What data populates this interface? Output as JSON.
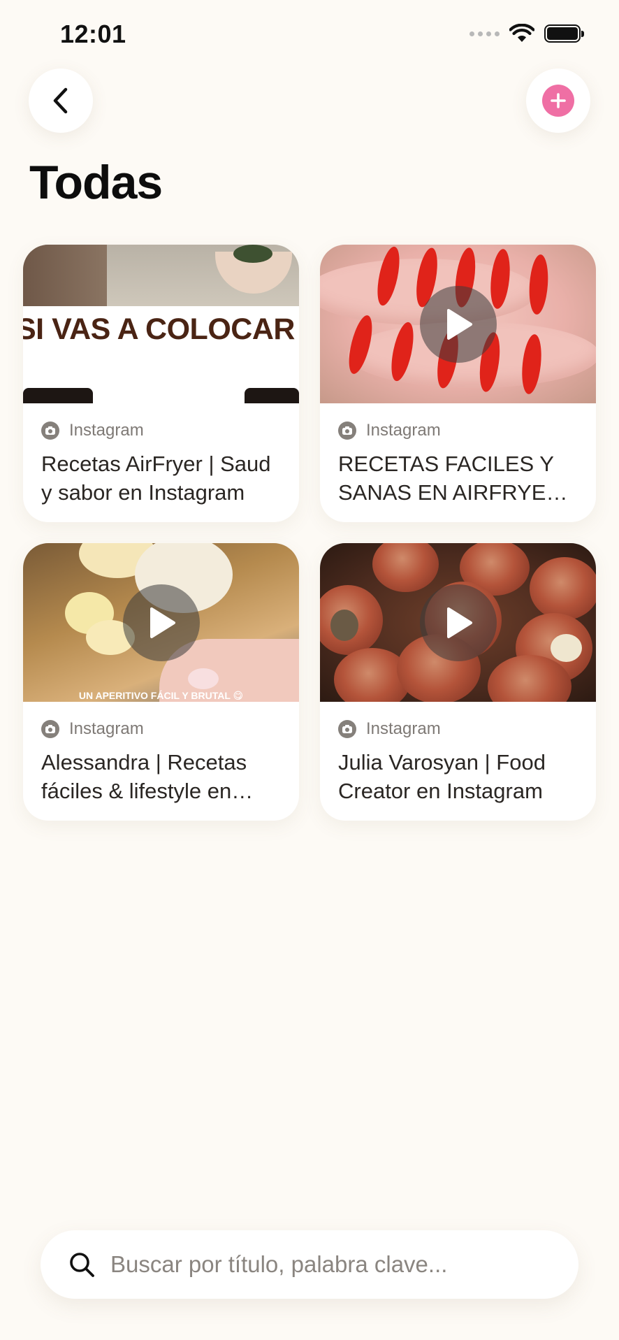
{
  "status": {
    "time": "12:01"
  },
  "header": {
    "title": "Todas",
    "back_label": "Back",
    "add_label": "Add"
  },
  "cards": [
    {
      "source": "Instagram",
      "title": "Recetas AirFryer | Saud y sabor en Instagram",
      "overlay_text": "SI VAS A COLOCAR EN LA AIR FRYER POLLO PICADO",
      "has_play": false
    },
    {
      "source": "Instagram",
      "title": "RECETAS FACILES Y SANAS EN AIRFRYER en Instagram",
      "has_play": true
    },
    {
      "source": "Instagram",
      "title": "Alessandra | Recetas fáciles & lifestyle en Instagram",
      "overlay_text": "UN APERITIVO FÁCIL Y BRUTAL 😋",
      "has_play": true
    },
    {
      "source": "Instagram",
      "title": "Julia Varosyan | Food Creator en Instagram",
      "has_play": true
    }
  ],
  "search": {
    "placeholder": "Buscar por título, palabra clave..."
  },
  "colors": {
    "background": "#fdfaf5",
    "accent": "#ef6fa4",
    "card": "#ffffff"
  }
}
